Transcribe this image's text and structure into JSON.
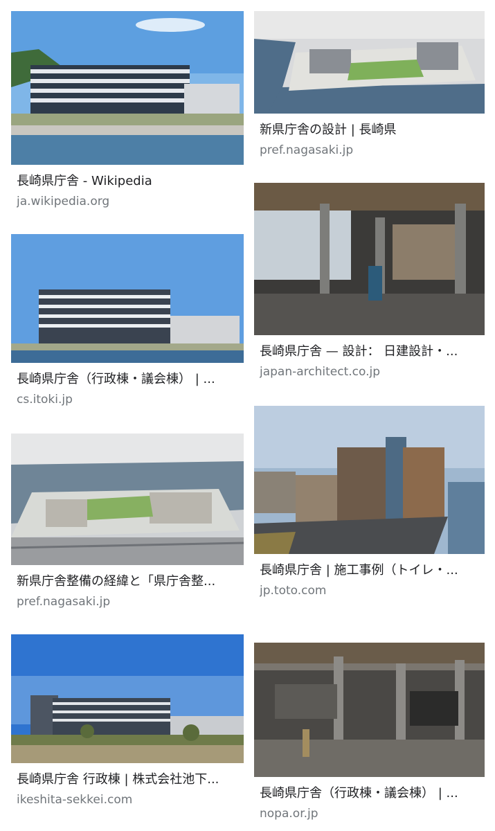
{
  "results": [
    {
      "title": "長崎県庁舎 - Wikipedia",
      "domain": "ja.wikipedia.org"
    },
    {
      "title": "新県庁舎の設計 | 長崎県",
      "domain": "pref.nagasaki.jp"
    },
    {
      "title": "長崎県庁舎 — 設計： 日建設計・...",
      "domain": "japan-architect.co.jp"
    },
    {
      "title": "長崎県庁舎（行政棟・議会棟） | ...",
      "domain": "cs.itoki.jp"
    },
    {
      "title": "新県庁舎整備の経緯と「県庁舎整...",
      "domain": "pref.nagasaki.jp"
    },
    {
      "title": "長崎県庁舎 | 施工事例（トイレ・...",
      "domain": "jp.toto.com"
    },
    {
      "title": "長崎県庁舎 行政棟 | 株式会社池下...",
      "domain": "ikeshita-sekkei.com"
    },
    {
      "title": "長崎県庁舎（行政棟・議会棟） | ...",
      "domain": "nopa.or.jp"
    }
  ]
}
